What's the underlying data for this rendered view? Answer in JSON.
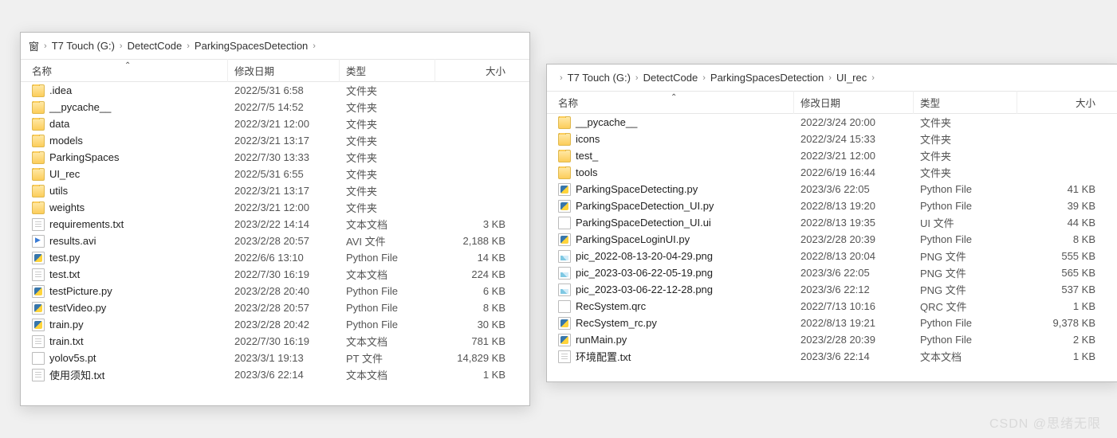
{
  "watermark": "CSDN @思绪无限",
  "columns": {
    "name": "名称",
    "date": "修改日期",
    "type": "类型",
    "size": "大小"
  },
  "left": {
    "breadcrumb": [
      "窗",
      "T7 Touch (G:)",
      "DetectCode",
      "ParkingSpacesDetection"
    ],
    "rows": [
      {
        "icon": "folder",
        "name": ".idea",
        "date": "2022/5/31 6:58",
        "type": "文件夹",
        "size": ""
      },
      {
        "icon": "folder",
        "name": "__pycache__",
        "date": "2022/7/5 14:52",
        "type": "文件夹",
        "size": ""
      },
      {
        "icon": "folder",
        "name": "data",
        "date": "2022/3/21 12:00",
        "type": "文件夹",
        "size": ""
      },
      {
        "icon": "folder",
        "name": "models",
        "date": "2022/3/21 13:17",
        "type": "文件夹",
        "size": ""
      },
      {
        "icon": "folder",
        "name": "ParkingSpaces",
        "date": "2022/7/30 13:33",
        "type": "文件夹",
        "size": ""
      },
      {
        "icon": "folder",
        "name": "UI_rec",
        "date": "2022/5/31 6:55",
        "type": "文件夹",
        "size": ""
      },
      {
        "icon": "folder",
        "name": "utils",
        "date": "2022/3/21 13:17",
        "type": "文件夹",
        "size": ""
      },
      {
        "icon": "folder",
        "name": "weights",
        "date": "2022/3/21 12:00",
        "type": "文件夹",
        "size": ""
      },
      {
        "icon": "txt",
        "name": "requirements.txt",
        "date": "2023/2/22 14:14",
        "type": "文本文档",
        "size": "3 KB"
      },
      {
        "icon": "avi",
        "name": "results.avi",
        "date": "2023/2/28 20:57",
        "type": "AVI 文件",
        "size": "2,188 KB"
      },
      {
        "icon": "py",
        "name": "test.py",
        "date": "2022/6/6 13:10",
        "type": "Python File",
        "size": "14 KB"
      },
      {
        "icon": "txt",
        "name": "test.txt",
        "date": "2022/7/30 16:19",
        "type": "文本文档",
        "size": "224 KB"
      },
      {
        "icon": "py",
        "name": "testPicture.py",
        "date": "2023/2/28 20:40",
        "type": "Python File",
        "size": "6 KB"
      },
      {
        "icon": "py",
        "name": "testVideo.py",
        "date": "2023/2/28 20:57",
        "type": "Python File",
        "size": "8 KB"
      },
      {
        "icon": "py",
        "name": "train.py",
        "date": "2023/2/28 20:42",
        "type": "Python File",
        "size": "30 KB"
      },
      {
        "icon": "txt",
        "name": "train.txt",
        "date": "2022/7/30 16:19",
        "type": "文本文档",
        "size": "781 KB"
      },
      {
        "icon": "generic",
        "name": "yolov5s.pt",
        "date": "2023/3/1 19:13",
        "type": "PT 文件",
        "size": "14,829 KB"
      },
      {
        "icon": "txt",
        "name": "使用须知.txt",
        "date": "2023/3/6 22:14",
        "type": "文本文档",
        "size": "1 KB"
      }
    ]
  },
  "right": {
    "breadcrumb": [
      "",
      "T7 Touch (G:)",
      "DetectCode",
      "ParkingSpacesDetection",
      "UI_rec"
    ],
    "rows": [
      {
        "icon": "folder",
        "name": "__pycache__",
        "date": "2022/3/24 20:00",
        "type": "文件夹",
        "size": ""
      },
      {
        "icon": "folder",
        "name": "icons",
        "date": "2022/3/24 15:33",
        "type": "文件夹",
        "size": ""
      },
      {
        "icon": "folder",
        "name": "test_",
        "date": "2022/3/21 12:00",
        "type": "文件夹",
        "size": ""
      },
      {
        "icon": "folder",
        "name": "tools",
        "date": "2022/6/19 16:44",
        "type": "文件夹",
        "size": ""
      },
      {
        "icon": "py",
        "name": "ParkingSpaceDetecting.py",
        "date": "2023/3/6 22:05",
        "type": "Python File",
        "size": "41 KB"
      },
      {
        "icon": "py",
        "name": "ParkingSpaceDetection_UI.py",
        "date": "2022/8/13 19:20",
        "type": "Python File",
        "size": "39 KB"
      },
      {
        "icon": "generic",
        "name": "ParkingSpaceDetection_UI.ui",
        "date": "2022/8/13 19:35",
        "type": "UI 文件",
        "size": "44 KB"
      },
      {
        "icon": "py",
        "name": "ParkingSpaceLoginUI.py",
        "date": "2023/2/28 20:39",
        "type": "Python File",
        "size": "8 KB"
      },
      {
        "icon": "png",
        "name": "pic_2022-08-13-20-04-29.png",
        "date": "2022/8/13 20:04",
        "type": "PNG 文件",
        "size": "555 KB"
      },
      {
        "icon": "png",
        "name": "pic_2023-03-06-22-05-19.png",
        "date": "2023/3/6 22:05",
        "type": "PNG 文件",
        "size": "565 KB"
      },
      {
        "icon": "png",
        "name": "pic_2023-03-06-22-12-28.png",
        "date": "2023/3/6 22:12",
        "type": "PNG 文件",
        "size": "537 KB"
      },
      {
        "icon": "generic",
        "name": "RecSystem.qrc",
        "date": "2022/7/13 10:16",
        "type": "QRC 文件",
        "size": "1 KB"
      },
      {
        "icon": "py",
        "name": "RecSystem_rc.py",
        "date": "2022/8/13 19:21",
        "type": "Python File",
        "size": "9,378 KB"
      },
      {
        "icon": "py",
        "name": "runMain.py",
        "date": "2023/2/28 20:39",
        "type": "Python File",
        "size": "2 KB"
      },
      {
        "icon": "txt",
        "name": "环境配置.txt",
        "date": "2023/3/6 22:14",
        "type": "文本文档",
        "size": "1 KB"
      }
    ]
  }
}
